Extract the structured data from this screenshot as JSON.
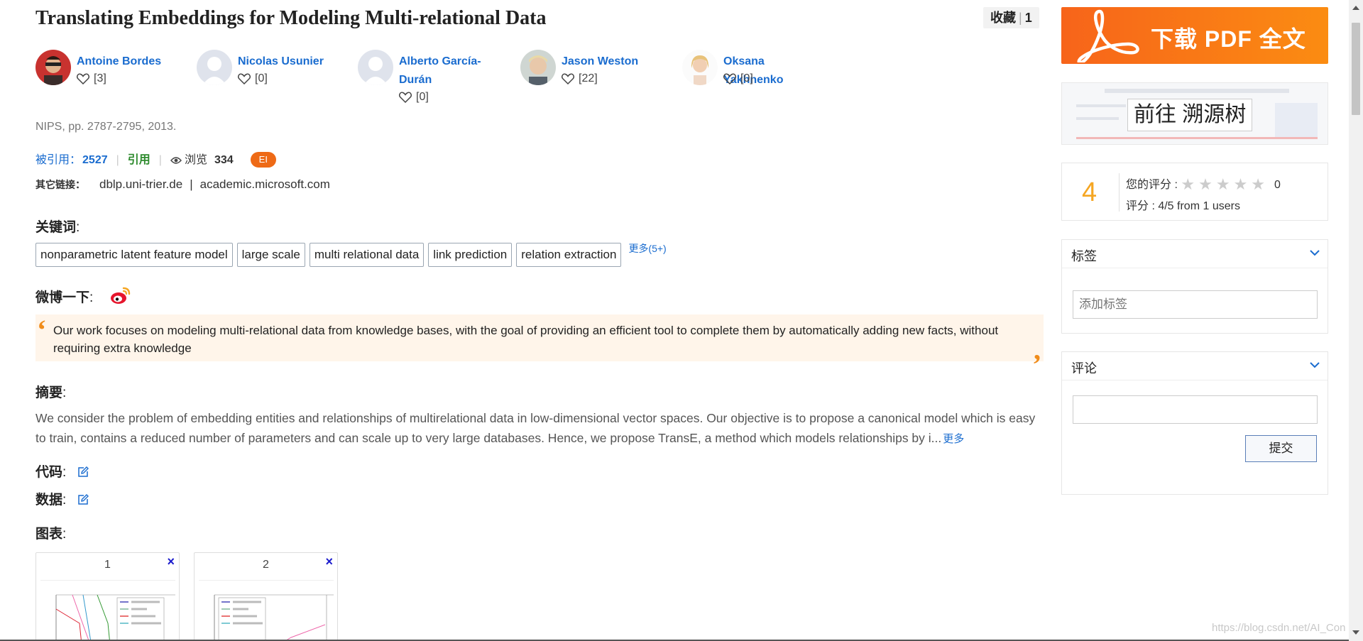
{
  "paper": {
    "title": "Translating Embeddings for Modeling Multi-relational Data",
    "venue": "NIPS, pp. 2787-2795, 2013."
  },
  "favorite": {
    "label": "收藏",
    "count": "1"
  },
  "authors": [
    {
      "name": "Antoine Bordes",
      "likes": "[3]"
    },
    {
      "name": "Nicolas Usunier",
      "likes": "[0]"
    },
    {
      "name": "Alberto García-Durán",
      "likes": "[0]"
    },
    {
      "name": "Jason Weston",
      "likes": "[22]"
    },
    {
      "name": "Oksana Yakhnenko",
      "likes": "[0]"
    }
  ],
  "stats": {
    "cited_label": "被引用：",
    "cited_count": "2527",
    "quote_label": "引用",
    "views_label": "浏览",
    "views_count": "334",
    "badge": "EI"
  },
  "links": {
    "label": "其它链接：",
    "items": [
      "dblp.uni-trier.de",
      "academic.microsoft.com"
    ],
    "separator": "|"
  },
  "keywords": {
    "heading": "关键词",
    "items": [
      "nonparametric latent feature model",
      "large scale",
      "multi relational data",
      "link prediction",
      "relation extraction"
    ],
    "more": "更多(5+)"
  },
  "weibo": {
    "heading": "微博一下"
  },
  "summary": {
    "text": "Our work focuses on modeling multi-relational data from knowledge bases, with the goal of providing an efficient tool to complete them by automatically adding new facts, without requiring extra knowledge"
  },
  "abstract": {
    "heading": "摘要",
    "text": "We consider the problem of embedding entities and relationships of multirelational data in low-dimensional vector spaces. Our objective is to propose a canonical model which is easy to train, contains a reduced number of parameters and can scale up to very large databases. Hence, we propose TransE, a method which models relationships by i...",
    "more": "更多"
  },
  "code": {
    "heading": "代码"
  },
  "data": {
    "heading": "数据"
  },
  "figures": {
    "heading": "图表",
    "items": [
      {
        "num": "1",
        "close": "×"
      },
      {
        "num": "2",
        "close": "×"
      }
    ]
  },
  "sidebar": {
    "pdf_label": "下载 PDF 全文",
    "trace_label": "前往 溯源树",
    "rating": {
      "big": "4",
      "my_label": "您的评分 :",
      "my_score": "0",
      "stars": 5,
      "summary": "评分 : 4/5 from 1 users"
    },
    "tags": {
      "title": "标签",
      "placeholder": "添加标签"
    },
    "comments": {
      "title": "评论",
      "submit": "提交"
    }
  },
  "colors": {
    "accent_blue": "#1a6ccf",
    "orange": "#f88c13",
    "quote_green": "#2e8b2e",
    "ei_badge": "#ee6a16"
  },
  "watermark": "https://blog.csdn.net/AI_Con"
}
